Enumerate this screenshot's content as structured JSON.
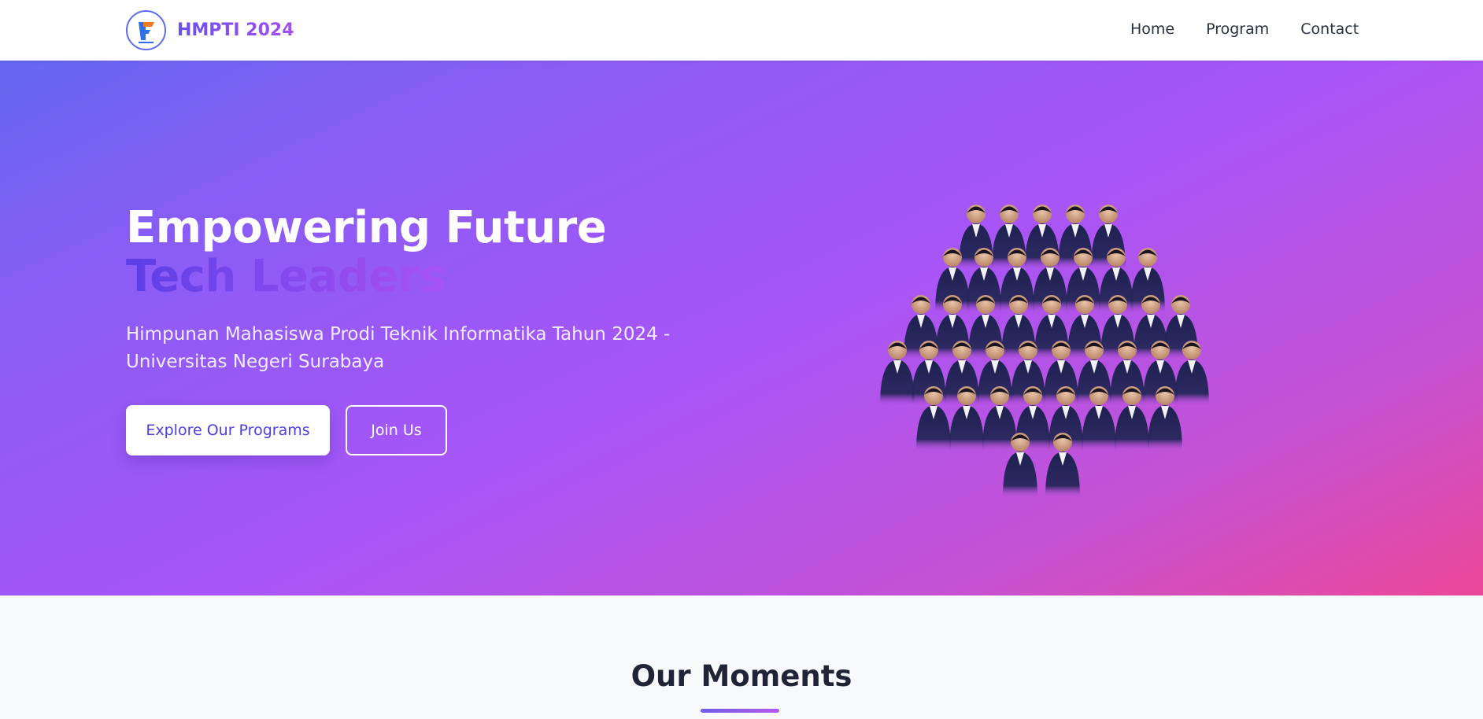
{
  "navbar": {
    "brand": "HMPTI 2024",
    "logo_icon": "hmpti-logo-icon",
    "links": [
      {
        "label": "Home"
      },
      {
        "label": "Program"
      },
      {
        "label": "Contact"
      }
    ]
  },
  "hero": {
    "title_main": "Empowering Future ",
    "title_accent": "Tech Leaders",
    "subtitle": "Himpunan Mahasiswa Prodi Teknik Informatika Tahun 2024 - Universitas Negeri Surabaya",
    "primary_button": "Explore Our Programs",
    "secondary_button": "Join Us",
    "gradient_colors": [
      "#6467f2",
      "#a855f7",
      "#ec4899"
    ]
  },
  "moments": {
    "title": "Our Moments"
  }
}
